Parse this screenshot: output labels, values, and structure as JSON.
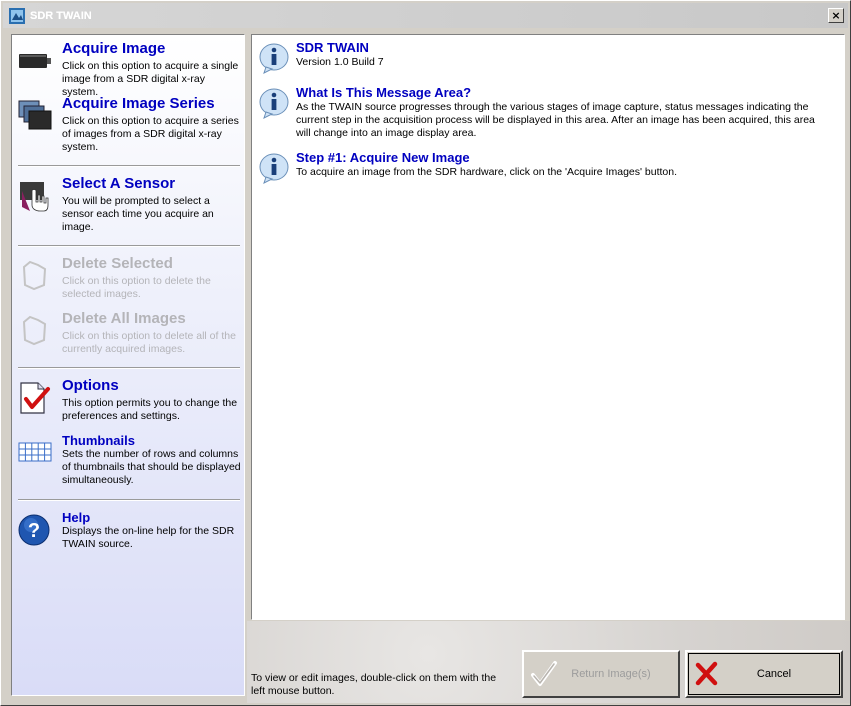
{
  "window": {
    "title": "SDR TWAIN",
    "close_label": "×"
  },
  "sidebar": {
    "items": [
      {
        "title": "Acquire Image",
        "desc": "Click on this option to acquire a single image from a SDR digital x-ray system.",
        "icon": "camera-icon",
        "enabled": true
      },
      {
        "title": "Acquire Image Series",
        "desc": "Click on this option to acquire a series of images from a SDR digital x-ray system.",
        "icon": "image-series-icon",
        "enabled": true
      },
      {
        "title": "Select A Sensor",
        "desc": "You will be prompted to select a sensor each time you acquire an image.",
        "icon": "sensor-hand-icon",
        "enabled": true
      },
      {
        "title": "Delete Selected",
        "desc": "Click on this option to delete the selected images.",
        "icon": "delete-icon",
        "enabled": false
      },
      {
        "title": "Delete All Images",
        "desc": "Click on this option to delete all of the currently acquired images.",
        "icon": "delete-all-icon",
        "enabled": false
      },
      {
        "title": "Options",
        "desc": "This option permits you to change the preferences and settings.",
        "icon": "options-check-icon",
        "enabled": true
      },
      {
        "title": "Thumbnails",
        "desc": "Sets the number of rows and columns of thumbnails that should be displayed simultaneously.",
        "icon": "grid-icon",
        "enabled": true
      },
      {
        "title": "Help",
        "desc": "Displays the on-line help for the SDR TWAIN source.",
        "icon": "help-icon",
        "enabled": true
      }
    ]
  },
  "messages": [
    {
      "title": "SDR TWAIN",
      "desc": "Version 1.0 Build 7",
      "icon": "info-icon"
    },
    {
      "title": "What Is This Message Area?",
      "desc": "As the TWAIN source progresses through the various stages of image capture, status messages indicating the current step in the acquisition process will be displayed in this area.  After an image has been acquired, this area will change into an image display area.",
      "icon": "info-icon"
    },
    {
      "title": "Step #1: Acquire New Image",
      "desc": "To acquire an image from the SDR hardware, click on the 'Acquire Images' button.",
      "icon": "info-icon"
    }
  ],
  "footer": {
    "hint": "To view or edit images, double-click on them with the left mouse button.",
    "return_label": "Return Image(s)",
    "cancel_label": "Cancel"
  },
  "colors": {
    "title_blue": "#0000c0",
    "disabled_gray": "#b4b4b8",
    "cancel_red": "#d01010"
  }
}
